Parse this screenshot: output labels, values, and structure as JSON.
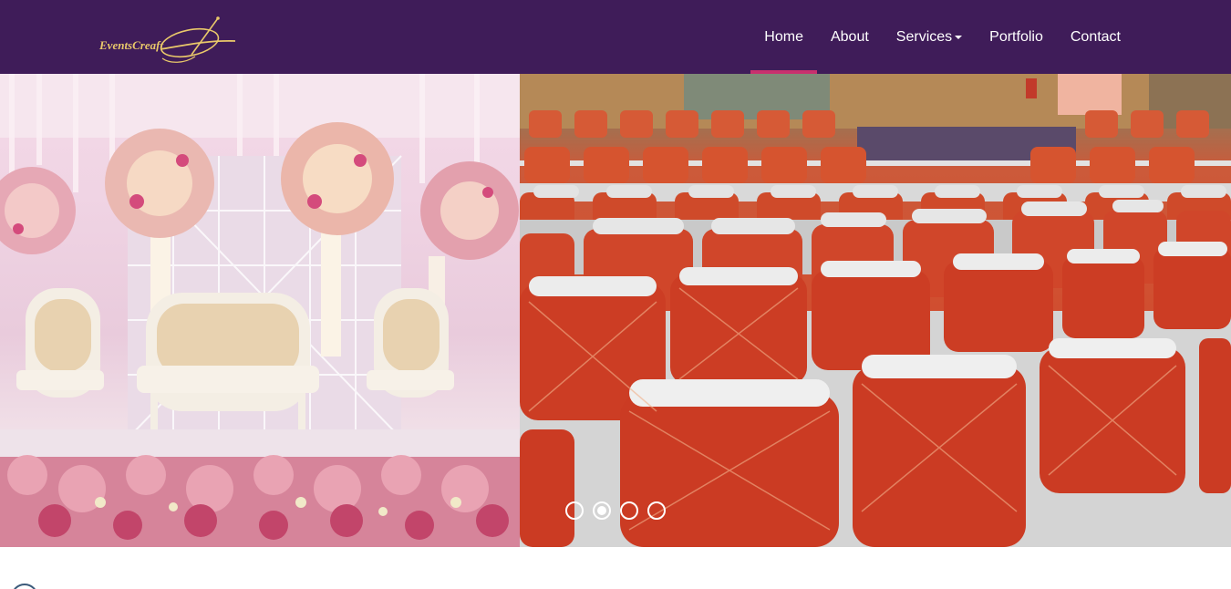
{
  "brand": {
    "logo_text": "EventsCreaft",
    "colors": {
      "navbar_bg": "#3f1c59",
      "active_underline": "#c8306e",
      "logo_gold": "#e9c86a"
    }
  },
  "nav": {
    "items": [
      {
        "label": "Home",
        "active": true
      },
      {
        "label": "About",
        "active": false
      },
      {
        "label": "Services",
        "active": false,
        "has_dropdown": true
      },
      {
        "label": "Portfolio",
        "active": false
      },
      {
        "label": "Contact",
        "active": false
      }
    ]
  },
  "hero": {
    "slides": [
      {
        "name": "wedding-stage-photo"
      },
      {
        "name": "banquet-chairs-photo"
      }
    ],
    "indicators": {
      "count": 4,
      "active_index": 1
    }
  }
}
